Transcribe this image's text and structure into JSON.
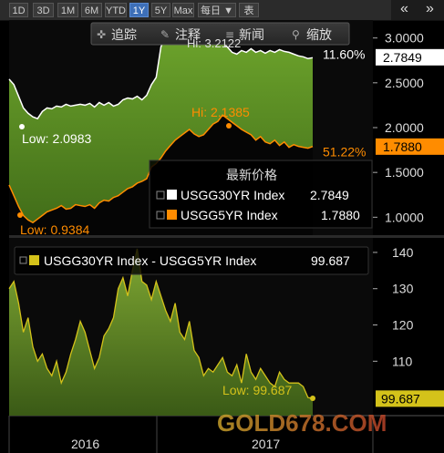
{
  "toolbar": {
    "ranges": [
      "1D",
      "3D",
      "1M",
      "6M",
      "YTD",
      "1Y",
      "5Y",
      "Max"
    ],
    "active_range": "1Y",
    "frequency": "每日 ▼",
    "table_label": "表",
    "nav_prev": "«",
    "nav_next": "»"
  },
  "chart_menu": {
    "track": "追踪",
    "annotate": "注释",
    "news": "新闻",
    "zoom": "缩放"
  },
  "legend": {
    "title": "最新价格",
    "items": [
      {
        "name": "USGG30YR Index",
        "value": "2.7849",
        "color": "#ffffff"
      },
      {
        "name": "USGG5YR Index",
        "value": "1.7880",
        "color": "#ff8c00"
      }
    ]
  },
  "lower_legend": {
    "name": "USGG30YR Index - USGG5YR Index",
    "value": "99.687",
    "color": "#d4c21a"
  },
  "watermark": "GOLD678.COM",
  "chart_data": [
    {
      "type": "area",
      "x_labels": [
        "2016",
        "2017"
      ],
      "y_ticks": [
        "3.0000",
        "2.5000",
        "2.0000",
        "1.5000",
        "1.0000"
      ],
      "y_tick_values": [
        3.0,
        2.5,
        2.0,
        1.5,
        1.0
      ],
      "ylim": [
        0.8,
        3.2
      ],
      "series": [
        {
          "name": "USGG30YR Index",
          "color": "#8bc34a",
          "values": [
            2.54,
            2.48,
            2.35,
            2.22,
            2.16,
            2.12,
            2.1,
            2.18,
            2.22,
            2.21,
            2.24,
            2.23,
            2.26,
            2.24,
            2.25,
            2.26,
            2.25,
            2.27,
            2.23,
            2.28,
            2.25,
            2.28,
            2.24,
            2.26,
            2.31,
            2.33,
            2.32,
            2.35,
            2.31,
            2.36,
            2.48,
            2.56,
            2.9,
            3.02,
            2.98,
            3.1,
            3.04,
            3.12,
            3.08,
            3.07,
            3.05,
            3.0,
            2.98,
            3.03,
            2.98,
            2.95,
            2.9,
            2.84,
            2.82,
            2.86,
            2.84,
            2.88,
            2.84,
            2.86,
            2.83,
            2.86,
            2.84,
            2.87,
            2.85,
            2.84,
            2.82,
            2.8,
            2.79,
            2.77,
            2.78
          ]
        },
        {
          "name": "USGG5YR Index",
          "color": "#ff8c00",
          "values": [
            1.36,
            1.24,
            1.12,
            1.02,
            0.97,
            0.94,
            0.98,
            1.02,
            1.06,
            1.08,
            1.1,
            1.13,
            1.09,
            1.1,
            1.14,
            1.13,
            1.12,
            1.14,
            1.1,
            1.16,
            1.19,
            1.18,
            1.22,
            1.24,
            1.28,
            1.32,
            1.34,
            1.38,
            1.4,
            1.43,
            1.56,
            1.6,
            1.66,
            1.74,
            1.8,
            1.86,
            1.9,
            1.94,
            1.98,
            1.93,
            1.9,
            1.92,
            1.98,
            2.04,
            2.07,
            2.14,
            2.1,
            2.06,
            2.02,
            1.98,
            1.95,
            1.92,
            1.86,
            1.9,
            1.84,
            1.82,
            1.86,
            1.8,
            1.84,
            1.78,
            1.81,
            1.79,
            1.78,
            1.77,
            1.79
          ]
        }
      ],
      "annotations": [
        {
          "text": "Hi: 3.2122",
          "series": 0
        },
        {
          "text": "Low: 2.0983",
          "series": 0
        },
        {
          "text": "Hi: 2.1385",
          "series": 1
        },
        {
          "text": "Low: 0.9384",
          "series": 1
        }
      ],
      "right_labels": [
        {
          "text": "11.60%",
          "value": 2.82,
          "color": "#ffffff"
        },
        {
          "text": "51.22%",
          "value": 1.73,
          "color": "#ff8c00"
        }
      ],
      "last_values": [
        {
          "text": "2.7849",
          "value": 2.7849
        },
        {
          "text": "1.7880",
          "value": 1.788
        }
      ]
    },
    {
      "type": "area",
      "y_ticks": [
        "140",
        "130",
        "120",
        "110"
      ],
      "y_tick_values": [
        140,
        130,
        120,
        110
      ],
      "ylim": [
        95,
        144
      ],
      "series": [
        {
          "name": "USGG30YR Index - USGG5YR Index",
          "color": "#d4c21a",
          "values": [
            130,
            132,
            126,
            118,
            122,
            114,
            110,
            112,
            108,
            106,
            110,
            104,
            107,
            112,
            116,
            121,
            118,
            113,
            108,
            111,
            117,
            119,
            122,
            130,
            133,
            128,
            135,
            141,
            132,
            131,
            127,
            132,
            128,
            124,
            121,
            126,
            118,
            116,
            121,
            113,
            111,
            106,
            108,
            107,
            109,
            111,
            107,
            106,
            109,
            104,
            112,
            107,
            105,
            108,
            106,
            104,
            103,
            107,
            105,
            104,
            104,
            104,
            103,
            100,
            99.687
          ]
        }
      ],
      "annotations": [
        {
          "text": "Low: 99.687",
          "series": 0
        }
      ],
      "last_values": [
        {
          "text": "99.687",
          "value": 99.687
        }
      ]
    }
  ]
}
